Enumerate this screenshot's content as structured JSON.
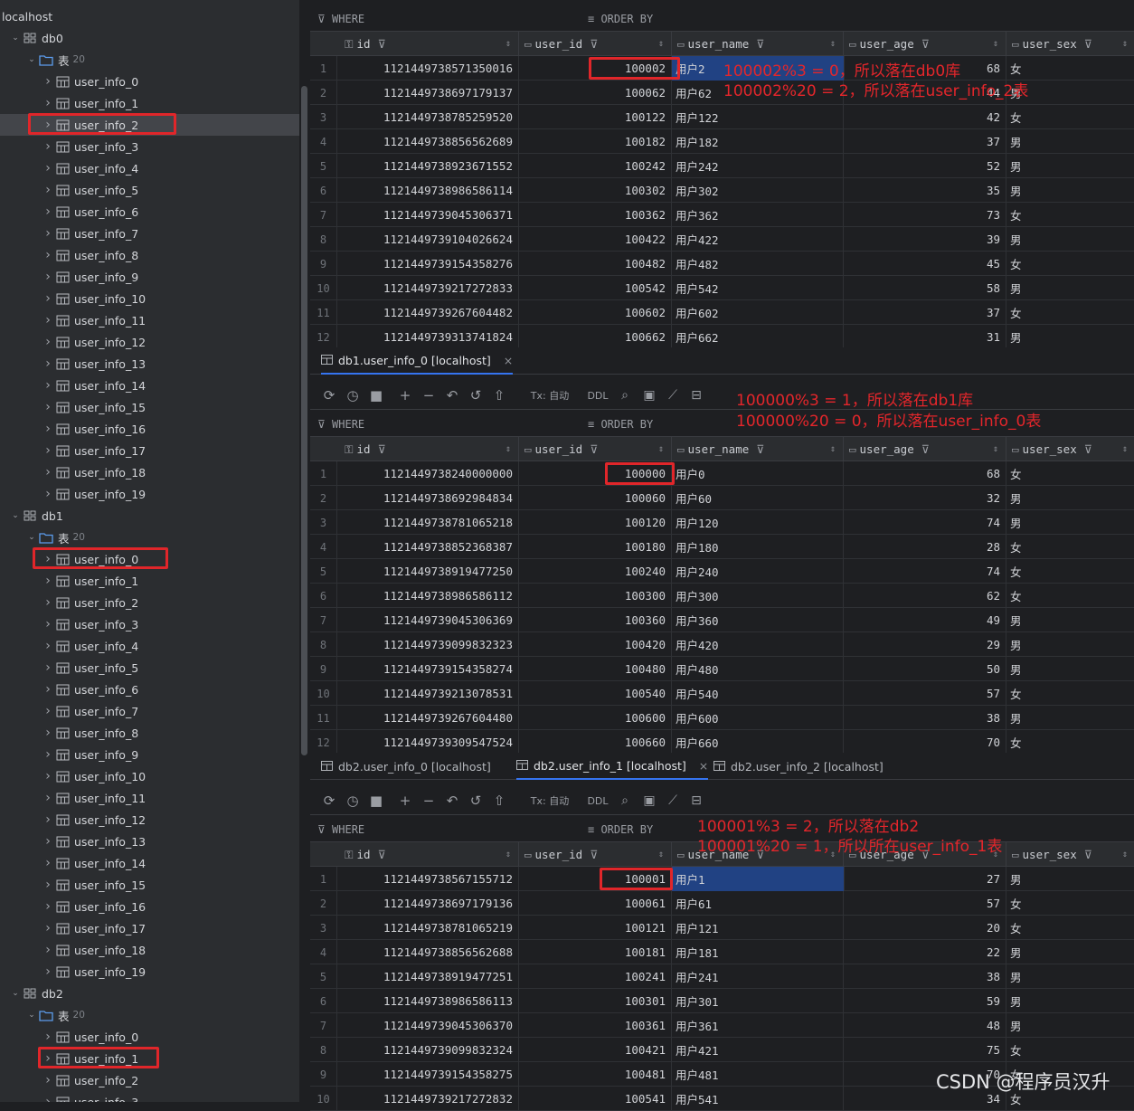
{
  "tree": {
    "root": "localhost",
    "databases": [
      {
        "name": "db0",
        "folder": "表",
        "count": "20"
      },
      {
        "name": "db1",
        "folder": "表",
        "count": "20"
      },
      {
        "name": "db2",
        "folder": "表",
        "count": "20"
      }
    ],
    "tables": [
      "user_info_0",
      "user_info_1",
      "user_info_2",
      "user_info_3",
      "user_info_4",
      "user_info_5",
      "user_info_6",
      "user_info_7",
      "user_info_8",
      "user_info_9",
      "user_info_10",
      "user_info_11",
      "user_info_12",
      "user_info_13",
      "user_info_14",
      "user_info_15",
      "user_info_16",
      "user_info_17",
      "user_info_18",
      "user_info_19"
    ]
  },
  "filter": {
    "where": "WHERE",
    "order_by": "ORDER BY"
  },
  "columns": [
    "id",
    "user_id",
    "user_name",
    "user_age",
    "user_sex"
  ],
  "toolbar": {
    "tx": "Tx: 自动",
    "ddl": "DDL"
  },
  "pane1": {
    "rows": [
      [
        "1",
        "1121449738571350016",
        "100002",
        "用户2",
        "68",
        "女"
      ],
      [
        "2",
        "1121449738697179137",
        "100062",
        "用户62",
        "44",
        "男"
      ],
      [
        "3",
        "1121449738785259520",
        "100122",
        "用户122",
        "42",
        "女"
      ],
      [
        "4",
        "1121449738856562689",
        "100182",
        "用户182",
        "37",
        "男"
      ],
      [
        "5",
        "1121449738923671552",
        "100242",
        "用户242",
        "52",
        "男"
      ],
      [
        "6",
        "1121449738986586114",
        "100302",
        "用户302",
        "35",
        "男"
      ],
      [
        "7",
        "1121449739045306371",
        "100362",
        "用户362",
        "73",
        "女"
      ],
      [
        "8",
        "1121449739104026624",
        "100422",
        "用户422",
        "39",
        "男"
      ],
      [
        "9",
        "1121449739154358276",
        "100482",
        "用户482",
        "45",
        "女"
      ],
      [
        "10",
        "1121449739217272833",
        "100542",
        "用户542",
        "58",
        "男"
      ],
      [
        "11",
        "1121449739267604482",
        "100602",
        "用户602",
        "37",
        "女"
      ],
      [
        "12",
        "1121449739313741824",
        "100662",
        "用户662",
        "31",
        "男"
      ]
    ]
  },
  "pane2": {
    "tabs": [
      "db1.user_info_0 [localhost]"
    ],
    "rows": [
      [
        "1",
        "1121449738240000000",
        "100000",
        "用户0",
        "68",
        "女"
      ],
      [
        "2",
        "1121449738692984834",
        "100060",
        "用户60",
        "32",
        "男"
      ],
      [
        "3",
        "1121449738781065218",
        "100120",
        "用户120",
        "74",
        "男"
      ],
      [
        "4",
        "1121449738852368387",
        "100180",
        "用户180",
        "28",
        "女"
      ],
      [
        "5",
        "1121449738919477250",
        "100240",
        "用户240",
        "74",
        "女"
      ],
      [
        "6",
        "1121449738986586112",
        "100300",
        "用户300",
        "62",
        "女"
      ],
      [
        "7",
        "1121449739045306369",
        "100360",
        "用户360",
        "49",
        "男"
      ],
      [
        "8",
        "1121449739099832323",
        "100420",
        "用户420",
        "29",
        "男"
      ],
      [
        "9",
        "1121449739154358274",
        "100480",
        "用户480",
        "50",
        "男"
      ],
      [
        "10",
        "1121449739213078531",
        "100540",
        "用户540",
        "57",
        "女"
      ],
      [
        "11",
        "1121449739267604480",
        "100600",
        "用户600",
        "38",
        "男"
      ],
      [
        "12",
        "1121449739309547524",
        "100660",
        "用户660",
        "70",
        "女"
      ]
    ]
  },
  "pane3": {
    "tabs": [
      "db2.user_info_0 [localhost]",
      "db2.user_info_1 [localhost]",
      "db2.user_info_2 [localhost]"
    ],
    "rows": [
      [
        "1",
        "1121449738567155712",
        "100001",
        "用户1",
        "27",
        "男"
      ],
      [
        "2",
        "1121449738697179136",
        "100061",
        "用户61",
        "57",
        "女"
      ],
      [
        "3",
        "1121449738781065219",
        "100121",
        "用户121",
        "20",
        "女"
      ],
      [
        "4",
        "1121449738856562688",
        "100181",
        "用户181",
        "22",
        "男"
      ],
      [
        "5",
        "1121449738919477251",
        "100241",
        "用户241",
        "38",
        "男"
      ],
      [
        "6",
        "1121449738986586113",
        "100301",
        "用户301",
        "59",
        "男"
      ],
      [
        "7",
        "1121449739045306370",
        "100361",
        "用户361",
        "48",
        "男"
      ],
      [
        "8",
        "1121449739099832324",
        "100421",
        "用户421",
        "75",
        "女"
      ],
      [
        "9",
        "1121449739154358275",
        "100481",
        "用户481",
        "70",
        "女"
      ],
      [
        "10",
        "1121449739217272832",
        "100541",
        "用户541",
        "34",
        "女"
      ]
    ]
  },
  "annotations": {
    "a1": "100002%3 = 0，所以落在db0库",
    "a2": "100002%20 = 2，所以落在user_info_2表",
    "b1": "100000%3 = 1，所以落在db1库",
    "b2": "100000%20 = 0，所以落在user_info_0表",
    "c1": "100001%3 = 2，所以落在db2",
    "c2": "100001%20 = 1，所以所在user_info_1表"
  },
  "watermark": "CSDN @程序员汉升",
  "colors": {
    "accent": "#3574f0",
    "annotation_red": "#e4262b",
    "selection": "#214283"
  }
}
